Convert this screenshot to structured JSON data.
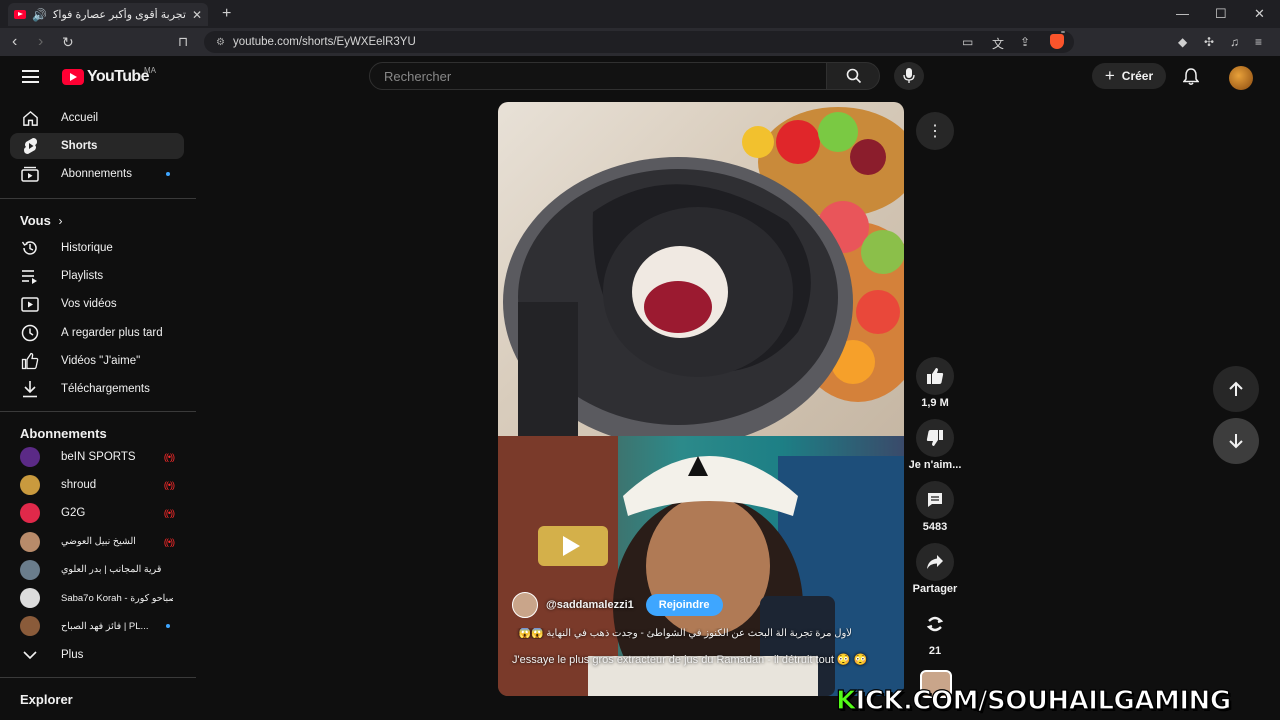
{
  "browser": {
    "tab_title": "تجربة أقوى وأكبر عصارة فواكة",
    "url": "youtube.com/shorts/EyWXEelR3YU"
  },
  "header": {
    "logo_text": "YouTube",
    "country_code": "MA",
    "search_placeholder": "Rechercher",
    "create_label": "Créer"
  },
  "sidebar": {
    "main": [
      {
        "label": "Accueil",
        "icon": "home-icon"
      },
      {
        "label": "Shorts",
        "icon": "shorts-icon",
        "active": true
      },
      {
        "label": "Abonnements",
        "icon": "subscriptions-icon",
        "dot": true
      }
    ],
    "you_heading": "Vous",
    "you": [
      {
        "label": "Historique",
        "icon": "history-icon"
      },
      {
        "label": "Playlists",
        "icon": "playlists-icon"
      },
      {
        "label": "Vos vidéos",
        "icon": "your-videos-icon"
      },
      {
        "label": "À regarder plus tard",
        "icon": "watch-later-icon"
      },
      {
        "label": "Vidéos \"J'aime\"",
        "icon": "liked-icon"
      },
      {
        "label": "Téléchargements",
        "icon": "downloads-icon"
      }
    ],
    "subs_heading": "Abonnements",
    "subscriptions": [
      {
        "name": "beIN SPORTS",
        "live": true,
        "color": "#5b2a86"
      },
      {
        "name": "shroud",
        "live": true,
        "color": "#c99a3e"
      },
      {
        "name": "G2G",
        "live": true,
        "color": "#e0294a"
      },
      {
        "name": "الشيخ نبيل العوضي",
        "live": true,
        "color": "#b88b6a"
      },
      {
        "name": "قرية المجانب | بدر العلوي",
        "live": false,
        "color": "#6a7d8c"
      },
      {
        "name": "Saba7o Korah - صباحو كورة",
        "live": false,
        "color": "#dcdcdc"
      },
      {
        "name": "فائز فهد الصباح | PL...",
        "live": false,
        "dot": true,
        "color": "#8a5b3a"
      }
    ],
    "more_label": "Plus",
    "explore_heading": "Explorer"
  },
  "short": {
    "channel": "@saddamalezzi1",
    "join_label": "Rejoindre",
    "arabic_caption": "لأول مرة تجربة آلة البحث عن الكنوز في الشواطئ - وجدت ذهب في النهاية 😱😱",
    "description": "J'essaye le plus gros extracteur de jus du Ramadan - il détruit tout 😳 😳"
  },
  "actions": {
    "likes": "1,9 M",
    "dislike_label": "Je n'aim...",
    "comments": "5483",
    "share_label": "Partager",
    "remix_count": "21"
  },
  "overlay": {
    "watermark_k": "K",
    "watermark_rest": "ICK.COM/SOUHAILGAMING"
  },
  "colors": {
    "accent_red": "#ff0033",
    "join_blue": "#3ea6ff",
    "kick_green": "#53fc18"
  }
}
